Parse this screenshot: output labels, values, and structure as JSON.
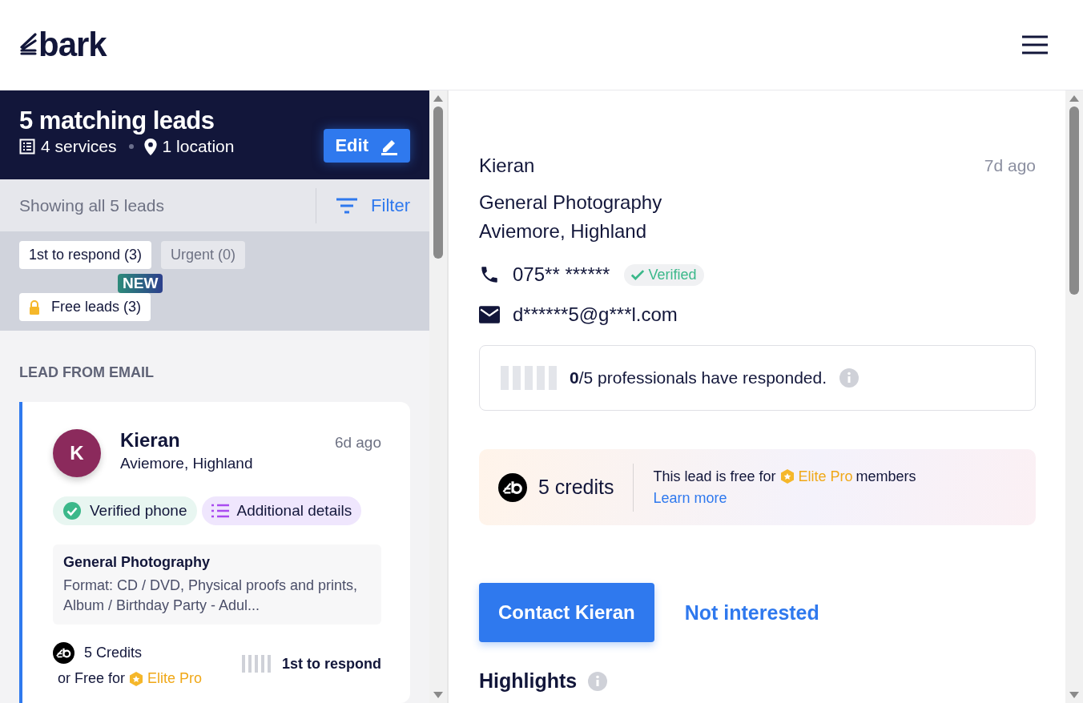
{
  "header": {
    "logo": "bark"
  },
  "summary": {
    "title": "5 matching leads",
    "services": "4 services",
    "location": "1 location",
    "edit": "Edit"
  },
  "filter_bar": {
    "showing": "Showing all 5 leads",
    "filter": "Filter"
  },
  "chips": [
    {
      "label": "1st to respond (3)",
      "kind": "plain",
      "disabled": false
    },
    {
      "label": "Urgent (0)",
      "kind": "plain",
      "disabled": true
    },
    {
      "label": "Free leads (3)",
      "kind": "free",
      "disabled": false,
      "badge": "NEW"
    }
  ],
  "section_label": "LEAD FROM EMAIL",
  "lead_card": {
    "selected": true,
    "initial": "K",
    "name": "Kieran",
    "location": "Aviemore, Highland",
    "time": "6d ago",
    "tags": [
      {
        "kind": "verified",
        "label": "Verified phone"
      },
      {
        "kind": "details",
        "label": "Additional details"
      }
    ],
    "service": "General Photography",
    "details": "Format: CD / DVD, Physical proofs and prints, Album / Birthday Party - Adul...",
    "credits": "5 Credits",
    "free_prefix": "or Free for",
    "free_tier": "Elite Pro",
    "response": "1st to respond"
  },
  "detail": {
    "name": "Kieran",
    "time": "7d ago",
    "service": "General Photography",
    "location": "Aviemore, Highland",
    "phone": "075** ******",
    "phone_badge": "Verified",
    "email": "d******5@g***l.com",
    "responses": "**0**/5 professionals have responded.",
    "credits": "5 credits",
    "free_note": "This lead is free for",
    "free_tier": "Elite Pro",
    "free_suffix": "members",
    "learn_more": "Learn more",
    "contact": "Contact Kieran",
    "not_interested": "Not interested",
    "highlights": "Highlights"
  }
}
